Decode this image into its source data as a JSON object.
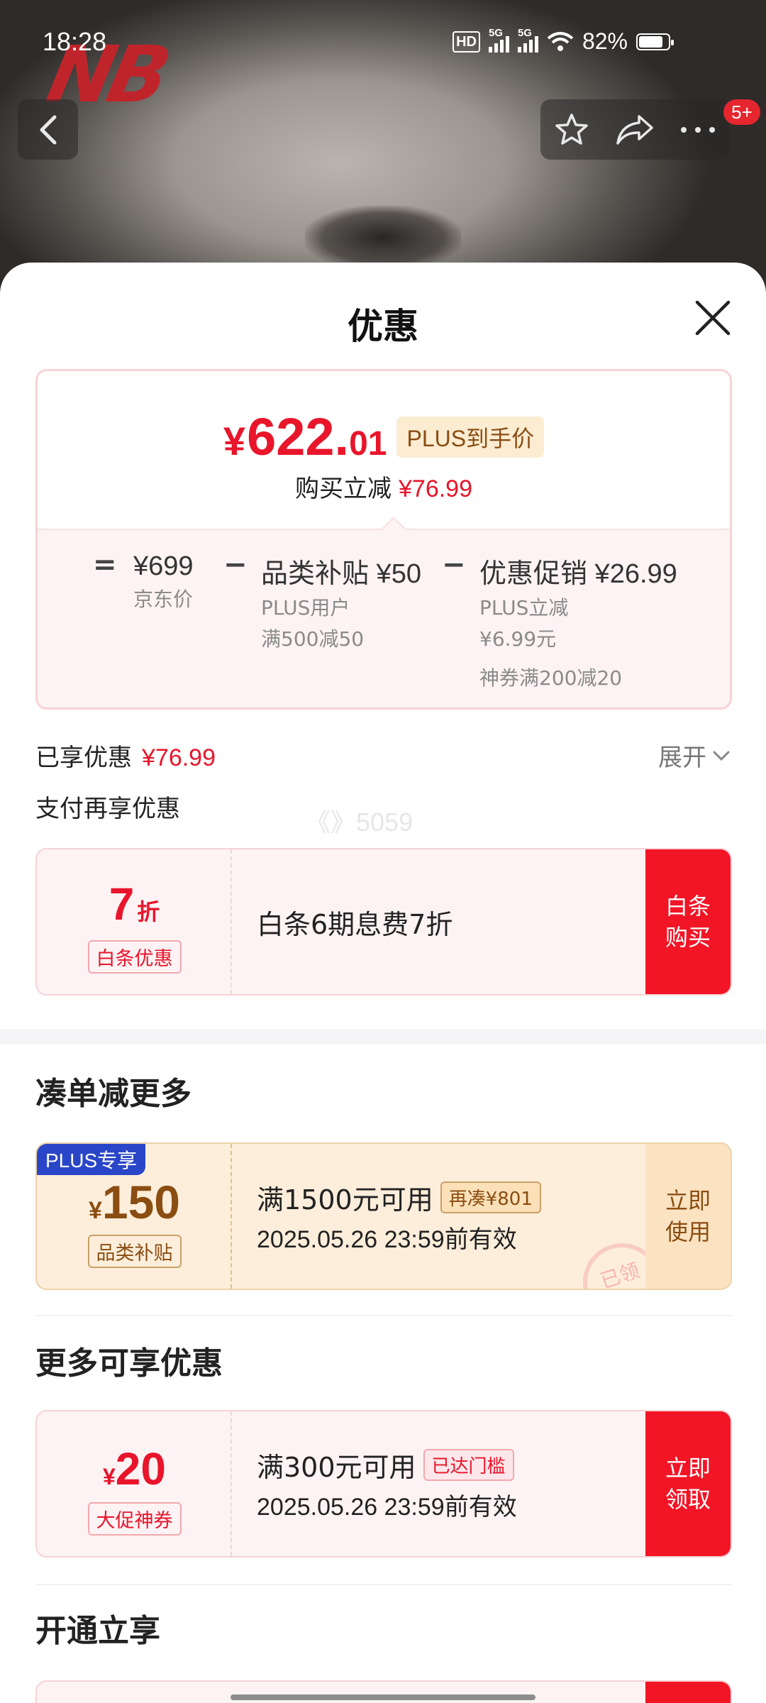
{
  "status_bar": {
    "time": "18:28",
    "hd_label": "HD",
    "net1": "5G",
    "net2": "5G",
    "battery": "82%"
  },
  "nav": {
    "badge": "5+"
  },
  "sheet": {
    "title": "优惠"
  },
  "price_card": {
    "yen": "¥",
    "price_int": "622.",
    "price_dec": "01",
    "plus_tag": "PLUS到手价",
    "save_label": "购买立减",
    "save_amount": "¥76.99",
    "eq": "=",
    "minus": "−",
    "jd_price": "¥699",
    "jd_price_label": "京东价",
    "subsidy": "品类补贴 ¥50",
    "subsidy_sub1": "PLUS用户",
    "subsidy_sub2": "满500减50",
    "promo": "优惠促销 ¥26.99",
    "promo_sub1": "PLUS立减",
    "promo_sub2": "¥6.99元",
    "promo_sub3": "神券满200减20"
  },
  "enjoyed": {
    "label": "已享优惠",
    "amount": "¥76.99",
    "expand": "展开"
  },
  "pay_more": {
    "title": "支付再享优惠",
    "coupon": {
      "value": "7",
      "unit": "折",
      "tag": "白条优惠",
      "desc": "白条6期息费7折",
      "button": "白条\n购买"
    }
  },
  "watermark": "《》5059",
  "section_more": {
    "title": "凑单减更多",
    "coupon": {
      "corner": "PLUS专享",
      "yen": "¥",
      "value": "150",
      "tag": "品类补贴",
      "title": "满1500元可用",
      "chip": "再凑¥801",
      "date": "2025.05.26 23:59前有效",
      "button": "立即\n使用",
      "stamp": "已领"
    }
  },
  "section_extra": {
    "title": "更多可享优惠",
    "coupon": {
      "yen": "¥",
      "value": "20",
      "tag": "大促神券",
      "title": "满300元可用",
      "chip": "已达门槛",
      "date": "2025.05.26 23:59前有效",
      "button": "立即\n领取"
    }
  },
  "section_open": {
    "title": "开通立享"
  },
  "colors": {
    "accent_red": "#e8152b",
    "button_red": "#f21526",
    "plus_blue": "#2a46c8",
    "gold_text": "#8a4d12"
  }
}
